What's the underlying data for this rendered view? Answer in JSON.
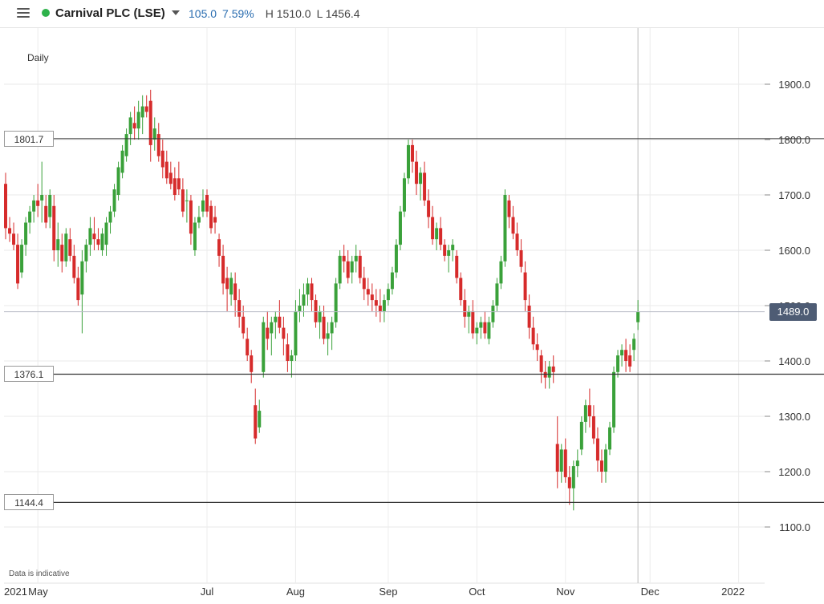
{
  "header": {
    "menu_icon": "menu-icon",
    "status_color": "#2eb24b",
    "instrument": "Carnival PLC (LSE)",
    "dropdown_icon": "chevron-down-icon",
    "change_value": "105.0",
    "change_percent": "7.59%",
    "high_label": "H 1510.0",
    "low_label": "L 1456.4",
    "change_color": "#2a6db0"
  },
  "timeframe": "Daily",
  "disclaimer": "Data is indicative",
  "last_price": {
    "value": 1489.0,
    "label": "1489.0",
    "color": "#4e5c74"
  },
  "levels": [
    {
      "value": 1801.7,
      "label": "1801.7"
    },
    {
      "value": 1376.1,
      "label": "1376.1"
    },
    {
      "value": 1144.4,
      "label": "1144.4"
    }
  ],
  "chart_data": {
    "type": "candlestick",
    "ylim": [
      1050,
      1990
    ],
    "y_ticks": [
      {
        "v": 1900,
        "label": "1900.0"
      },
      {
        "v": 1800,
        "label": "1800.0"
      },
      {
        "v": 1700,
        "label": "1700.0"
      },
      {
        "v": 1600,
        "label": "1600.0"
      },
      {
        "v": 1500,
        "label": "1500.0"
      },
      {
        "v": 1400,
        "label": "1400.0"
      },
      {
        "v": 1300,
        "label": "1300.0"
      },
      {
        "v": 1200,
        "label": "1200.0"
      },
      {
        "v": 1100,
        "label": "1100.0"
      }
    ],
    "x_labels": [
      "2021",
      "May",
      "Jul",
      "Aug",
      "Sep",
      "Oct",
      "Nov",
      "Dec",
      "2022"
    ],
    "x_ticks": [
      {
        "label": "2021",
        "index": -9
      },
      {
        "label": "May",
        "index": 8
      },
      {
        "label": "Jul",
        "index": 50
      },
      {
        "label": "Aug",
        "index": 72
      },
      {
        "label": "Sep",
        "index": 95
      },
      {
        "label": "Oct",
        "index": 117
      },
      {
        "label": "Nov",
        "index": 139
      },
      {
        "label": "Dec",
        "index": 160
      },
      {
        "label": "2022",
        "index": 182
      }
    ],
    "up_color": "#3aa13a",
    "down_color": "#d62b2b",
    "candles": [
      [
        1720,
        1740,
        1620,
        1640
      ],
      [
        1640,
        1660,
        1615,
        1630
      ],
      [
        1630,
        1650,
        1600,
        1610
      ],
      [
        1610,
        1630,
        1530,
        1540
      ],
      [
        1560,
        1620,
        1550,
        1610
      ],
      [
        1610,
        1660,
        1590,
        1650
      ],
      [
        1650,
        1680,
        1630,
        1670
      ],
      [
        1670,
        1700,
        1650,
        1690
      ],
      [
        1690,
        1720,
        1660,
        1680
      ],
      [
        1690,
        1760,
        1650,
        1700
      ],
      [
        1680,
        1700,
        1640,
        1650
      ],
      [
        1660,
        1710,
        1640,
        1700
      ],
      [
        1680,
        1700,
        1580,
        1600
      ],
      [
        1600,
        1650,
        1570,
        1620
      ],
      [
        1610,
        1630,
        1560,
        1580
      ],
      [
        1580,
        1640,
        1570,
        1630
      ],
      [
        1620,
        1640,
        1580,
        1590
      ],
      [
        1590,
        1610,
        1540,
        1550
      ],
      [
        1550,
        1570,
        1500,
        1510
      ],
      [
        1520,
        1600,
        1450,
        1580
      ],
      [
        1580,
        1620,
        1560,
        1610
      ],
      [
        1610,
        1660,
        1590,
        1640
      ],
      [
        1630,
        1660,
        1600,
        1620
      ],
      [
        1620,
        1640,
        1600,
        1610
      ],
      [
        1600,
        1640,
        1590,
        1630
      ],
      [
        1610,
        1660,
        1590,
        1650
      ],
      [
        1650,
        1680,
        1630,
        1670
      ],
      [
        1670,
        1720,
        1660,
        1710
      ],
      [
        1700,
        1760,
        1690,
        1750
      ],
      [
        1740,
        1790,
        1730,
        1780
      ],
      [
        1770,
        1820,
        1760,
        1810
      ],
      [
        1810,
        1850,
        1790,
        1840
      ],
      [
        1830,
        1860,
        1800,
        1820
      ],
      [
        1820,
        1870,
        1800,
        1850
      ],
      [
        1840,
        1880,
        1810,
        1860
      ],
      [
        1860,
        1880,
        1840,
        1850
      ],
      [
        1870,
        1890,
        1760,
        1790
      ],
      [
        1800,
        1840,
        1780,
        1820
      ],
      [
        1810,
        1830,
        1760,
        1770
      ],
      [
        1780,
        1800,
        1730,
        1750
      ],
      [
        1760,
        1780,
        1720,
        1730
      ],
      [
        1740,
        1760,
        1710,
        1720
      ],
      [
        1730,
        1750,
        1690,
        1700
      ],
      [
        1730,
        1760,
        1700,
        1710
      ],
      [
        1710,
        1730,
        1660,
        1670
      ],
      [
        1690,
        1710,
        1650,
        1690
      ],
      [
        1690,
        1700,
        1610,
        1630
      ],
      [
        1600,
        1660,
        1590,
        1650
      ],
      [
        1650,
        1680,
        1640,
        1660
      ],
      [
        1670,
        1710,
        1660,
        1690
      ],
      [
        1700,
        1710,
        1660,
        1670
      ],
      [
        1680,
        1690,
        1630,
        1640
      ],
      [
        1660,
        1680,
        1630,
        1650
      ],
      [
        1620,
        1630,
        1570,
        1590
      ],
      [
        1590,
        1610,
        1520,
        1540
      ],
      [
        1550,
        1570,
        1490,
        1530
      ],
      [
        1520,
        1560,
        1500,
        1550
      ],
      [
        1540,
        1560,
        1480,
        1510
      ],
      [
        1510,
        1530,
        1460,
        1480
      ],
      [
        1480,
        1500,
        1440,
        1450
      ],
      [
        1440,
        1460,
        1400,
        1410
      ],
      [
        1410,
        1420,
        1360,
        1380
      ],
      [
        1320,
        1350,
        1250,
        1260
      ],
      [
        1280,
        1330,
        1270,
        1310
      ],
      [
        1380,
        1480,
        1370,
        1470
      ],
      [
        1460,
        1490,
        1420,
        1440
      ],
      [
        1450,
        1480,
        1410,
        1470
      ],
      [
        1470,
        1490,
        1440,
        1480
      ],
      [
        1480,
        1510,
        1450,
        1460
      ],
      [
        1460,
        1480,
        1410,
        1440
      ],
      [
        1430,
        1450,
        1380,
        1400
      ],
      [
        1400,
        1420,
        1370,
        1410
      ],
      [
        1410,
        1510,
        1400,
        1490
      ],
      [
        1490,
        1530,
        1470,
        1500
      ],
      [
        1500,
        1540,
        1480,
        1520
      ],
      [
        1520,
        1550,
        1500,
        1540
      ],
      [
        1540,
        1550,
        1490,
        1510
      ],
      [
        1510,
        1520,
        1460,
        1470
      ],
      [
        1470,
        1500,
        1440,
        1490
      ],
      [
        1480,
        1500,
        1430,
        1440
      ],
      [
        1440,
        1470,
        1410,
        1450
      ],
      [
        1450,
        1480,
        1420,
        1470
      ],
      [
        1470,
        1550,
        1460,
        1540
      ],
      [
        1540,
        1600,
        1530,
        1590
      ],
      [
        1590,
        1610,
        1560,
        1580
      ],
      [
        1580,
        1600,
        1540,
        1550
      ],
      [
        1560,
        1590,
        1540,
        1580
      ],
      [
        1580,
        1610,
        1560,
        1590
      ],
      [
        1590,
        1600,
        1540,
        1550
      ],
      [
        1550,
        1570,
        1510,
        1530
      ],
      [
        1530,
        1550,
        1500,
        1520
      ],
      [
        1520,
        1540,
        1490,
        1510
      ],
      [
        1510,
        1530,
        1480,
        1500
      ],
      [
        1500,
        1530,
        1470,
        1490
      ],
      [
        1490,
        1520,
        1470,
        1510
      ],
      [
        1510,
        1540,
        1500,
        1530
      ],
      [
        1530,
        1570,
        1520,
        1560
      ],
      [
        1560,
        1620,
        1550,
        1610
      ],
      [
        1610,
        1680,
        1600,
        1670
      ],
      [
        1670,
        1740,
        1660,
        1730
      ],
      [
        1730,
        1800,
        1720,
        1790
      ],
      [
        1790,
        1800,
        1740,
        1760
      ],
      [
        1760,
        1780,
        1700,
        1720
      ],
      [
        1720,
        1750,
        1690,
        1740
      ],
      [
        1740,
        1760,
        1680,
        1690
      ],
      [
        1690,
        1710,
        1640,
        1660
      ],
      [
        1660,
        1680,
        1610,
        1620
      ],
      [
        1620,
        1650,
        1600,
        1640
      ],
      [
        1640,
        1660,
        1600,
        1610
      ],
      [
        1610,
        1620,
        1580,
        1590
      ],
      [
        1590,
        1610,
        1560,
        1600
      ],
      [
        1600,
        1620,
        1580,
        1610
      ],
      [
        1590,
        1600,
        1540,
        1550
      ],
      [
        1550,
        1560,
        1500,
        1510
      ],
      [
        1510,
        1530,
        1460,
        1480
      ],
      [
        1480,
        1500,
        1450,
        1490
      ],
      [
        1490,
        1510,
        1440,
        1450
      ],
      [
        1450,
        1470,
        1430,
        1460
      ],
      [
        1460,
        1480,
        1440,
        1470
      ],
      [
        1470,
        1490,
        1440,
        1450
      ],
      [
        1440,
        1480,
        1430,
        1470
      ],
      [
        1470,
        1510,
        1460,
        1500
      ],
      [
        1500,
        1550,
        1490,
        1540
      ],
      [
        1540,
        1590,
        1530,
        1580
      ],
      [
        1580,
        1710,
        1570,
        1700
      ],
      [
        1690,
        1700,
        1640,
        1660
      ],
      [
        1660,
        1680,
        1620,
        1630
      ],
      [
        1630,
        1650,
        1590,
        1600
      ],
      [
        1600,
        1620,
        1560,
        1570
      ],
      [
        1560,
        1580,
        1490,
        1510
      ],
      [
        1500,
        1520,
        1440,
        1460
      ],
      [
        1460,
        1480,
        1420,
        1430
      ],
      [
        1430,
        1450,
        1400,
        1420
      ],
      [
        1410,
        1420,
        1360,
        1380
      ],
      [
        1380,
        1400,
        1350,
        1370
      ],
      [
        1370,
        1400,
        1350,
        1390
      ],
      [
        1390,
        1410,
        1360,
        1380
      ],
      [
        1250,
        1300,
        1170,
        1200
      ],
      [
        1200,
        1250,
        1180,
        1240
      ],
      [
        1240,
        1260,
        1180,
        1190
      ],
      [
        1190,
        1210,
        1140,
        1170
      ],
      [
        1170,
        1220,
        1130,
        1210
      ],
      [
        1210,
        1240,
        1190,
        1220
      ],
      [
        1240,
        1300,
        1230,
        1290
      ],
      [
        1290,
        1330,
        1270,
        1320
      ],
      [
        1320,
        1350,
        1280,
        1300
      ],
      [
        1300,
        1320,
        1250,
        1260
      ],
      [
        1260,
        1280,
        1200,
        1220
      ],
      [
        1220,
        1240,
        1180,
        1200
      ],
      [
        1200,
        1250,
        1180,
        1240
      ],
      [
        1240,
        1290,
        1230,
        1280
      ],
      [
        1280,
        1390,
        1270,
        1380
      ],
      [
        1380,
        1420,
        1370,
        1410
      ],
      [
        1410,
        1430,
        1390,
        1420
      ],
      [
        1420,
        1440,
        1380,
        1400
      ],
      [
        1410,
        1430,
        1380,
        1390
      ],
      [
        1420,
        1450,
        1400,
        1440
      ],
      [
        1470,
        1510,
        1456,
        1489
      ]
    ]
  }
}
